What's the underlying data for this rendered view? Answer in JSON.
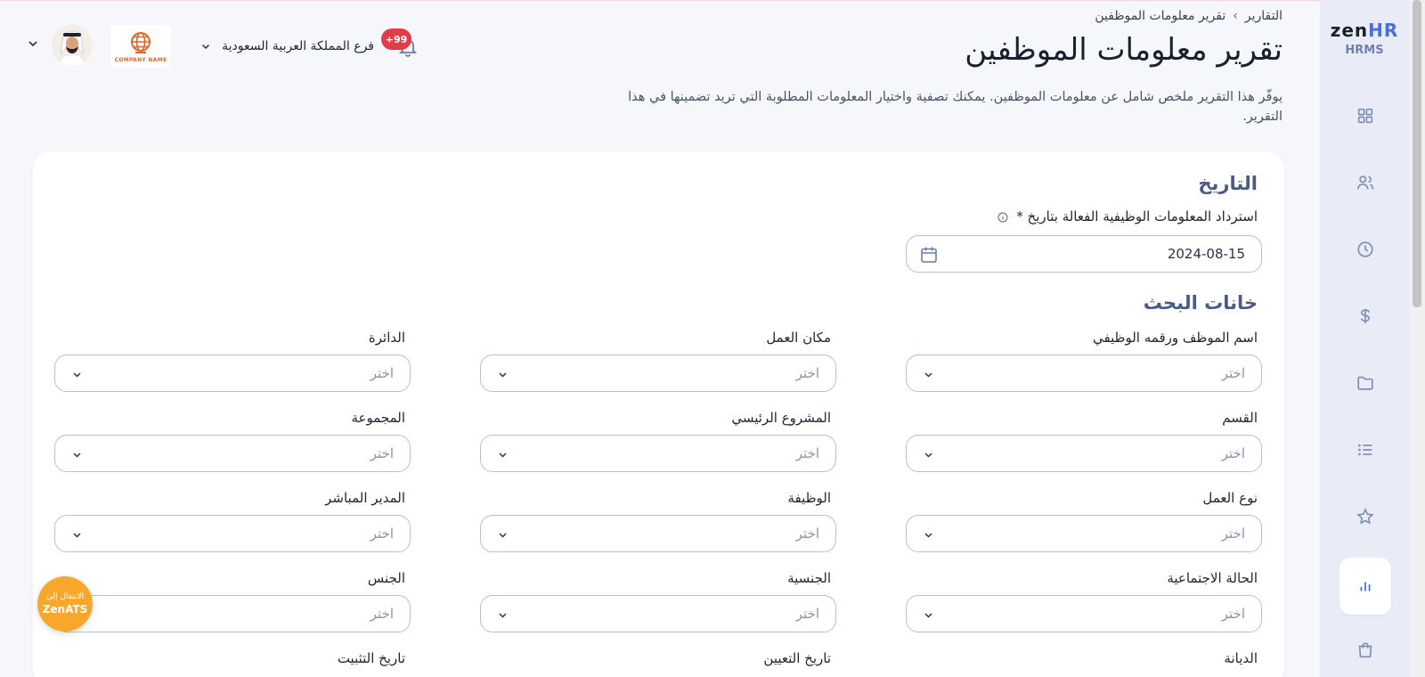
{
  "brand": {
    "logo_main": "zen",
    "logo_accent": "HR",
    "subtitle": "HRMS"
  },
  "header": {
    "breadcrumb": {
      "root": "التقارير",
      "current": "تقرير معلومات الموظفين"
    },
    "title": "تقرير معلومات الموظفين",
    "description": "يوفّر هذا التقرير ملخص شامل عن معلومات الموظفين. يمكنك تصفية واختيار المعلومات المطلوبة التي تريد تضمينها في هذا التقرير."
  },
  "topbar": {
    "branch_label": "فرع المملكة العربية السعودية",
    "notifications_badge": "+99",
    "company_logo_text": "COMPANY NAME"
  },
  "date_section": {
    "title": "التاريخ",
    "label": "استرداد المعلومات الوظيفية الفعالة بتاريخ",
    "required_mark": "*",
    "value": "2024-08-15"
  },
  "search_section": {
    "title": "خانات البحث",
    "placeholder": "اختر",
    "fields": [
      {
        "label": "اسم الموظف ورقمه الوظيفي"
      },
      {
        "label": "مكان العمل"
      },
      {
        "label": "الدائرة"
      },
      {
        "label": "القسم"
      },
      {
        "label": "المشروع الرئيسي"
      },
      {
        "label": "المجموعة"
      },
      {
        "label": "نوع العمل"
      },
      {
        "label": "الوظيفة"
      },
      {
        "label": "المدير المباشر"
      },
      {
        "label": "الحالة الاجتماعية"
      },
      {
        "label": "الجنسية"
      },
      {
        "label": "الجنس"
      },
      {
        "label": "الديانة"
      },
      {
        "label": "تاريخ التعيين"
      },
      {
        "label": "تاريخ التثبيت"
      }
    ]
  },
  "zenats": {
    "line1": "الانتقال إلى",
    "line2": "ZenATS"
  },
  "sidebar": {
    "items": [
      {
        "icon": "dashboard-icon"
      },
      {
        "icon": "users-icon"
      },
      {
        "icon": "clock-icon"
      },
      {
        "icon": "dollar-icon"
      },
      {
        "icon": "folder-icon"
      },
      {
        "icon": "list-icon"
      },
      {
        "icon": "star-icon"
      },
      {
        "icon": "reports-chart-icon",
        "active": true
      },
      {
        "icon": "shopping-bag-icon"
      }
    ]
  },
  "colors": {
    "accent": "#2c6fe0",
    "badge": "#e23b4a",
    "zenats": "#f7a72c",
    "rail": "#e9ecf7"
  }
}
